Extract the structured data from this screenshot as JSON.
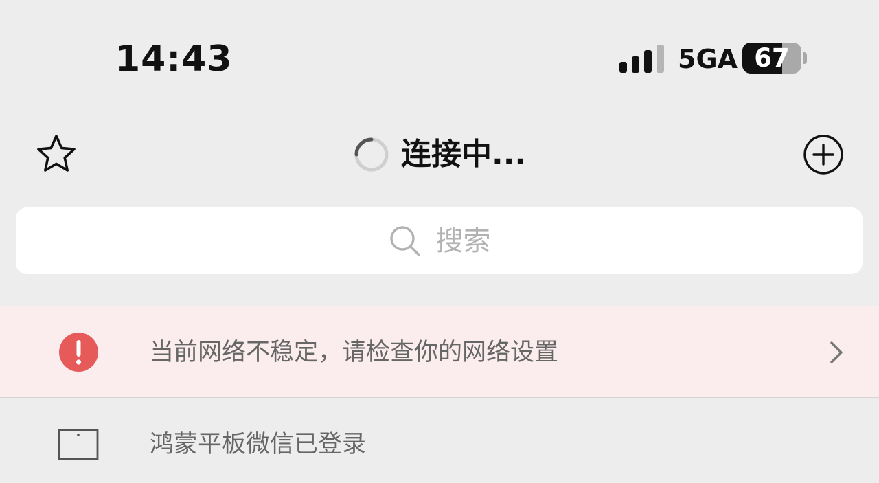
{
  "status_bar": {
    "time": "14:43",
    "signal_bars_filled": 3,
    "signal_bars_total": 4,
    "network": "5GA",
    "battery_percent": "67",
    "battery_level": 0.67
  },
  "header": {
    "title": "连接中...",
    "left_icon": "star-icon",
    "right_icon": "add-circle-icon",
    "title_icon": "loading-spinner-icon"
  },
  "search": {
    "placeholder": "搜索",
    "icon": "search-icon"
  },
  "notice": {
    "text": "当前网络不稳定，请检查你的网络设置",
    "icon": "alert-icon",
    "color": "#e65a5a",
    "background": "#fbeced"
  },
  "device_login": {
    "text": "鸿蒙平板微信已登录",
    "icon": "tablet-icon"
  }
}
